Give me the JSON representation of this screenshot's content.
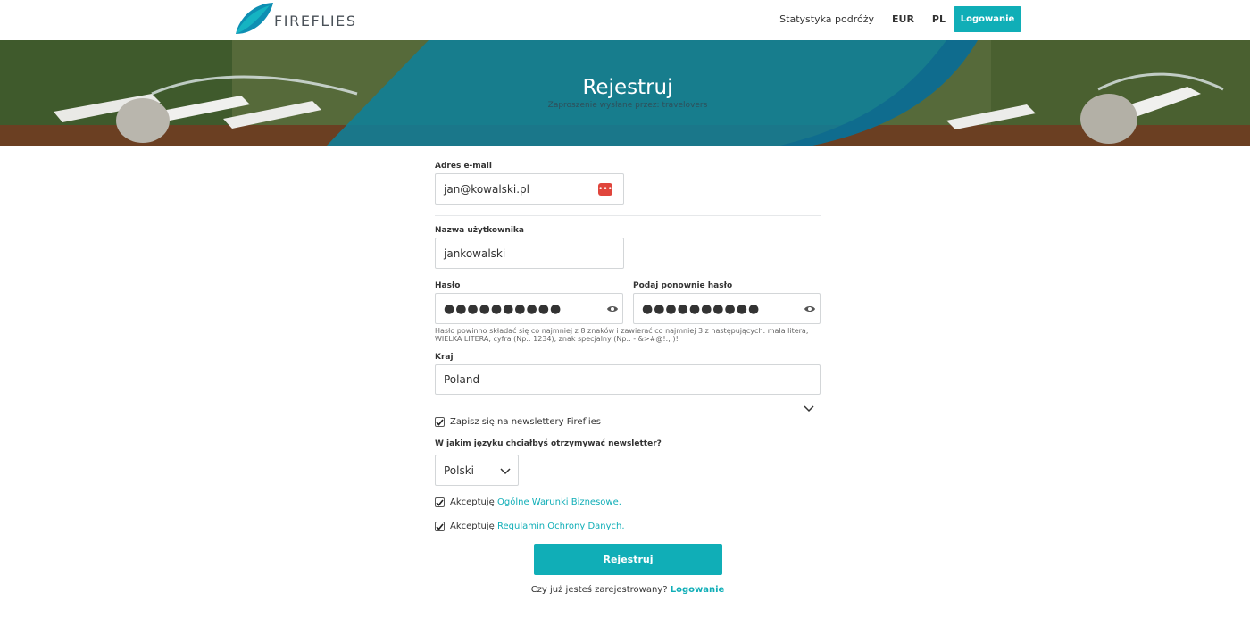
{
  "header": {
    "logo_text": "FIREFLIES",
    "nav": {
      "stats": "Statystyka podróży",
      "currency": "EUR",
      "language": "PL",
      "login": "Logowanie"
    }
  },
  "hero": {
    "title": "Rejestruj",
    "subtitle": "Zaproszenie wysłane przez: travelovers"
  },
  "form": {
    "email": {
      "label": "Adres e-mail",
      "value": "jan@kowalski.pl"
    },
    "username": {
      "label": "Nazwa użytkownika",
      "value": "jankowalski"
    },
    "password": {
      "label": "Hasło",
      "value": "●●●●●●●●●●"
    },
    "password_repeat": {
      "label": "Podaj ponownie hasło",
      "value": "●●●●●●●●●●"
    },
    "password_hint": "Hasło powinno składać się co najmniej z 8 znaków i zawierać co najmniej 3 z następujących: mała litera, WIELKA LITERA, cyfra (Np.: 1234), znak specjalny (Np.: -.&>#@!:; )!",
    "country": {
      "label": "Kraj",
      "value": "Poland"
    },
    "newsletter": {
      "label": "Zapisz się na newslettery Fireflies",
      "checked": true
    },
    "newsletter_lang": {
      "label": "W jakim języku chciałbyś otrzymywać newsletter?",
      "value": "Polski"
    },
    "terms": {
      "prefix": "Akceptuję",
      "link": "Ogólne Warunki Biznesowe.",
      "checked": true
    },
    "privacy": {
      "prefix": "Akceptuję",
      "link": "Regulamin Ochrony Danych.",
      "checked": true
    },
    "submit": "Rejestruj",
    "already": {
      "text": "Czy już jesteś zarejestrowany?",
      "link": "Logowanie"
    }
  },
  "colors": {
    "accent": "#10aeb7",
    "logo": "#0e8fb3"
  }
}
